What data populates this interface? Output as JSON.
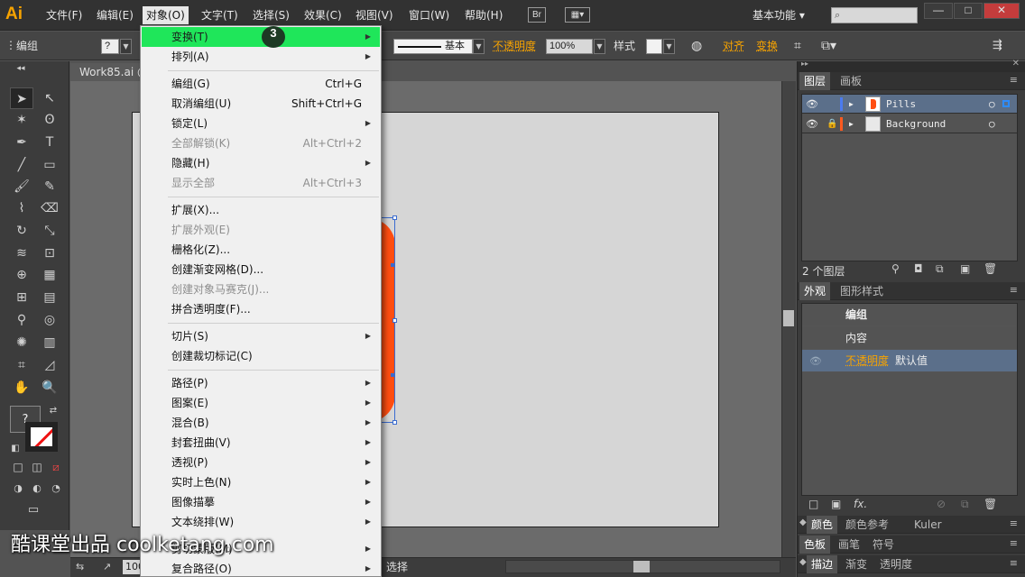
{
  "app": {
    "logo": "Ai"
  },
  "menubar": {
    "items": [
      "文件(F)",
      "编辑(E)",
      "对象(O)",
      "文字(T)",
      "选择(S)",
      "效果(C)",
      "视图(V)",
      "窗口(W)",
      "帮助(H)"
    ],
    "bridge": "Br",
    "workspace": "基本功能",
    "window_buttons": [
      "—",
      "□",
      "✕"
    ]
  },
  "controlbar": {
    "selection_label": "编组",
    "question": "?",
    "stroke_style": "基本",
    "opacity_label": "不透明度",
    "opacity_value": "100%",
    "style_label": "样式",
    "align_link": "对齐",
    "transform_link": "变换"
  },
  "document": {
    "tab_title": "Work85.ai @"
  },
  "object_menu": {
    "items": [
      {
        "label": "变换(T)",
        "shortcut": "",
        "submenu": true,
        "disabled": false,
        "highlight": true
      },
      {
        "label": "排列(A)",
        "shortcut": "",
        "submenu": true,
        "disabled": false
      },
      {
        "label": "编组(G)",
        "shortcut": "Ctrl+G",
        "submenu": false,
        "disabled": false
      },
      {
        "label": "取消编组(U)",
        "shortcut": "Shift+Ctrl+G",
        "submenu": false,
        "disabled": false
      },
      {
        "label": "锁定(L)",
        "shortcut": "",
        "submenu": true,
        "disabled": false
      },
      {
        "label": "全部解锁(K)",
        "shortcut": "Alt+Ctrl+2",
        "submenu": false,
        "disabled": true
      },
      {
        "label": "隐藏(H)",
        "shortcut": "",
        "submenu": true,
        "disabled": false
      },
      {
        "label": "显示全部",
        "shortcut": "Alt+Ctrl+3",
        "submenu": false,
        "disabled": true
      },
      {
        "label": "扩展(X)...",
        "shortcut": "",
        "submenu": false,
        "disabled": false
      },
      {
        "label": "扩展外观(E)",
        "shortcut": "",
        "submenu": false,
        "disabled": true
      },
      {
        "label": "栅格化(Z)...",
        "shortcut": "",
        "submenu": false,
        "disabled": false
      },
      {
        "label": "创建渐变网格(D)...",
        "shortcut": "",
        "submenu": false,
        "disabled": false
      },
      {
        "label": "创建对象马赛克(J)...",
        "shortcut": "",
        "submenu": false,
        "disabled": true
      },
      {
        "label": "拼合透明度(F)...",
        "shortcut": "",
        "submenu": false,
        "disabled": false
      },
      {
        "label": "切片(S)",
        "shortcut": "",
        "submenu": true,
        "disabled": false
      },
      {
        "label": "创建裁切标记(C)",
        "shortcut": "",
        "submenu": false,
        "disabled": false
      },
      {
        "label": "路径(P)",
        "shortcut": "",
        "submenu": true,
        "disabled": false
      },
      {
        "label": "图案(E)",
        "shortcut": "",
        "submenu": true,
        "disabled": false
      },
      {
        "label": "混合(B)",
        "shortcut": "",
        "submenu": true,
        "disabled": false
      },
      {
        "label": "封套扭曲(V)",
        "shortcut": "",
        "submenu": true,
        "disabled": false
      },
      {
        "label": "透视(P)",
        "shortcut": "",
        "submenu": true,
        "disabled": false
      },
      {
        "label": "实时上色(N)",
        "shortcut": "",
        "submenu": true,
        "disabled": false
      },
      {
        "label": "图像描摹",
        "shortcut": "",
        "submenu": true,
        "disabled": false
      },
      {
        "label": "文本绕排(W)",
        "shortcut": "",
        "submenu": true,
        "disabled": false
      },
      {
        "label": "剪切蒙版(M)",
        "shortcut": "",
        "submenu": true,
        "disabled": false
      },
      {
        "label": "复合路径(O)",
        "shortcut": "",
        "submenu": true,
        "disabled": false
      }
    ],
    "step_badge": "3"
  },
  "layers_panel": {
    "tabs": [
      "图层",
      "画板"
    ],
    "layers": [
      {
        "name": "Pills",
        "color": "#4b7bf0",
        "selected": true
      },
      {
        "name": "Background",
        "color": "#ff5a1f",
        "selected": false,
        "locked": true
      }
    ],
    "count": "2 个图层"
  },
  "appearance_panel": {
    "tabs": [
      "外观",
      "图形样式"
    ],
    "group_label": "编组",
    "contents_label": "内容",
    "opacity_label": "不透明度",
    "opacity_value": "默认值",
    "fx": "fx."
  },
  "bottom_panels": {
    "row1": [
      "颜色",
      "颜色参考",
      "Kuler"
    ],
    "row2": [
      "色板",
      "画笔",
      "符号"
    ],
    "row3": [
      "描边",
      "渐变",
      "透明度"
    ]
  },
  "statusbar": {
    "zoom": "100",
    "selection_tool": "选择"
  },
  "watermark": "酷课堂出品 coolketang.com",
  "colors": {
    "accent_orange": "#f7a300",
    "pill_orange": "#ff4e12",
    "menu_highlight": "#1fe65a",
    "selection_blue": "#3b6ccf"
  }
}
